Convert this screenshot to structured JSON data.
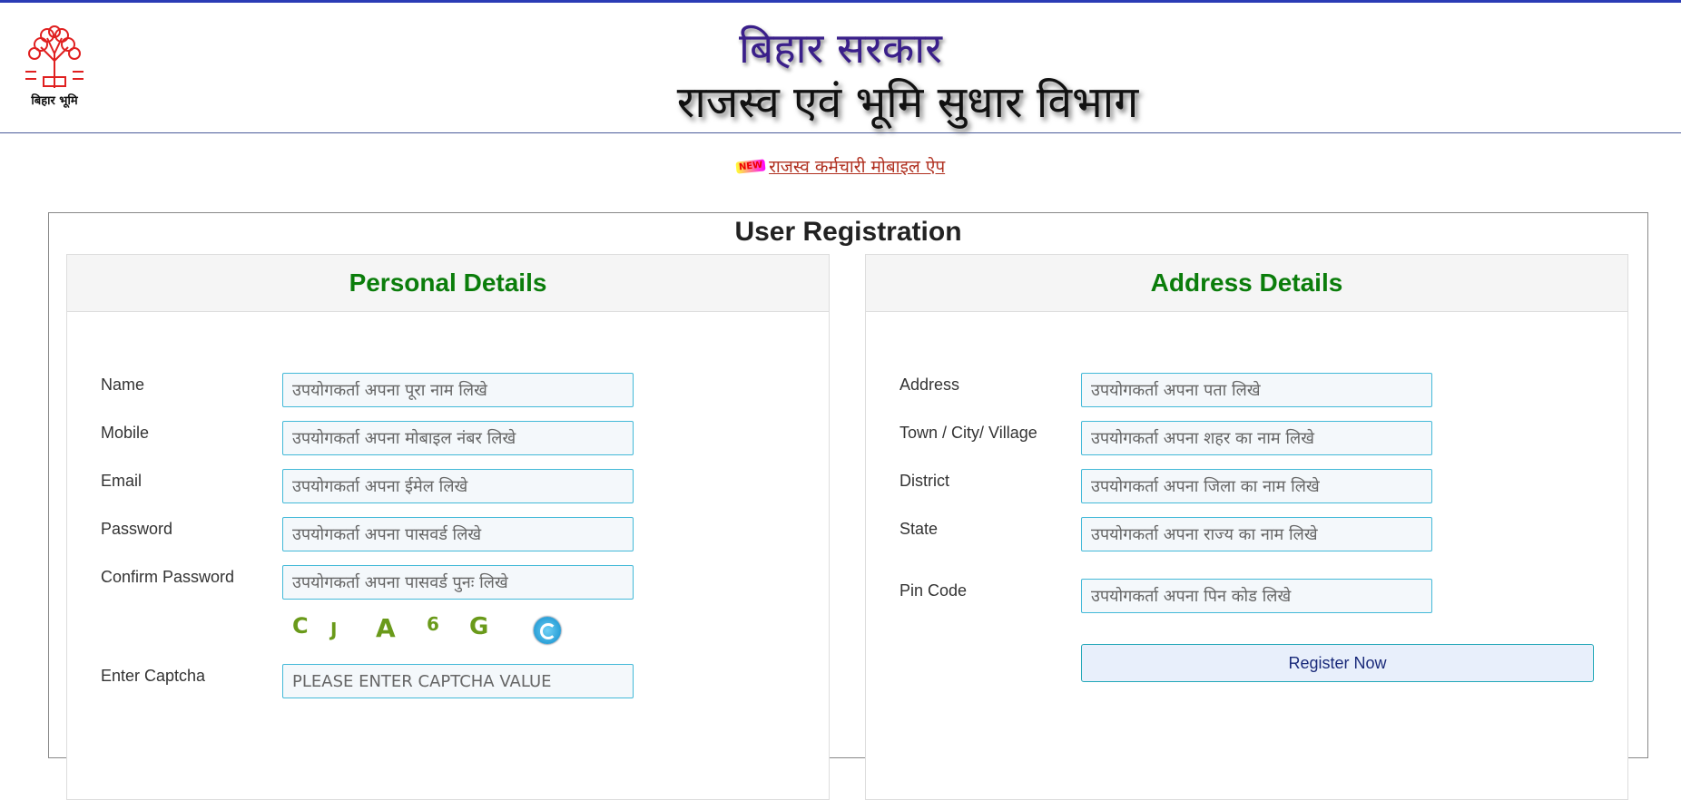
{
  "header": {
    "logo_text": "बिहार भूमि",
    "title_line1": "बिहार सरकार",
    "title_line2": "राजस्व एवं भूमि सुधार विभाग"
  },
  "app_link": {
    "badge": "NEW",
    "label": "राजस्व कर्मचारी मोबाइल ऐप"
  },
  "form": {
    "title": "User Registration",
    "personal": {
      "heading": "Personal Details",
      "name_label": "Name",
      "name_placeholder": "उपयोगकर्ता अपना पूरा नाम लिखे",
      "mobile_label": "Mobile",
      "mobile_placeholder": "उपयोगकर्ता अपना मोबाइल नंबर लिखे",
      "email_label": "Email",
      "email_placeholder": "उपयोगकर्ता अपना ईमेल लिखे",
      "password_label": "Password",
      "password_placeholder": "उपयोगकर्ता अपना पासवर्ड लिखे",
      "confirm_label": "Confirm Password",
      "confirm_placeholder": "उपयोगकर्ता अपना पासवर्ड पुनः लिखे",
      "captcha_chars": [
        "C",
        "J",
        "A",
        "6",
        "G"
      ],
      "captcha_label": "Enter Captcha",
      "captcha_placeholder": "PLEASE ENTER CAPTCHA VALUE"
    },
    "address": {
      "heading": "Address Details",
      "address_label": "Address",
      "address_placeholder": "उपयोगकर्ता अपना पता लिखे",
      "town_label": "Town / City/ Village",
      "town_placeholder": "उपयोगकर्ता अपना शहर का नाम लिखे",
      "district_label": "District",
      "district_placeholder": "उपयोगकर्ता अपना जिला का नाम लिखे",
      "state_label": "State",
      "state_placeholder": "उपयोगकर्ता अपना राज्य का नाम लिखे",
      "pin_label": "Pin Code",
      "pin_placeholder": "उपयोगकर्ता अपना पिन कोड लिखे",
      "register_label": "Register Now"
    }
  },
  "colors": {
    "accent_bar": "#2a3bb5",
    "heading_green": "#0b7d0b",
    "input_border": "#43b9d8",
    "link_red": "#b03020"
  }
}
